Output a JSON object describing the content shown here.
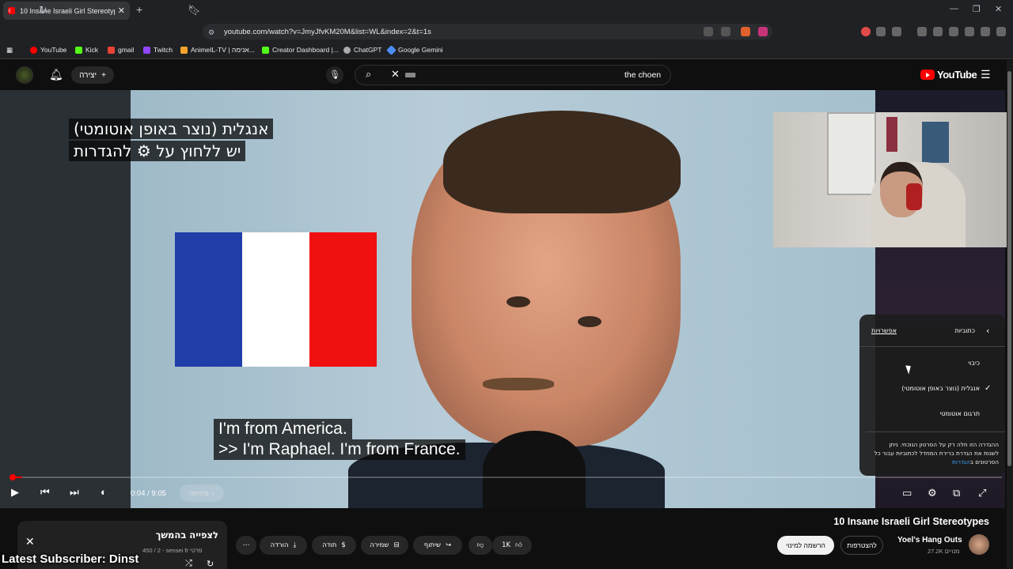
{
  "browser": {
    "tab_title": "10 Insane Israeli Girl Stereotypes",
    "url": "youtube.com/watch?v=JmyJfvKM20M&list=WL&index=2&t=1s",
    "bookmarks": [
      "YouTube",
      "Kick",
      "gmail",
      "Twitch",
      "AnimeIL-TV | אנימה...",
      "Creator Dashboard |...",
      "ChatGPT",
      "Google Gemini"
    ]
  },
  "header": {
    "create_label": "יצירה",
    "search_query": "the choen",
    "logo_text": "YouTube"
  },
  "video": {
    "caption_line1": "אנגלית (נוצר באופן אוטומטי)",
    "caption_line2": "יש ללחוץ על ⚙ להגדרות",
    "subtitle_line1": "I'm from America.",
    "subtitle_line2": ">> I'm Raphael. I'm from France.",
    "time": "0:04 / 9:05",
    "chapter": "פתיחה",
    "progress": 0.007
  },
  "settings_popup": {
    "back_label": "כתוביות",
    "options_label": "אפשרויות",
    "items": [
      "כיבוי",
      "אנגלית (נוצר באופן אוטומטי)",
      "תרגום אוטומטי"
    ],
    "selected_index": 1,
    "note": "ההגדרה הזו חלה רק על הסרטון הנוכחי. ניתן לשנות את הגדרת ברירת המחדל לכתוביות עבור כל הסרטונים ב",
    "note_link": "הגדרות"
  },
  "below": {
    "title": "10 Insane Israeli Girl Stereotypes",
    "channel": "Yoel's Hang Outs",
    "subscribers": "27.2K מנויים",
    "join_label": "להצטרפות",
    "subscribe_label": "הרשמה למינוי",
    "likes": "1K",
    "share_label": "שיתוף",
    "save_label": "שמירה",
    "thanks_label": "תודה",
    "download_label": "הורדה"
  },
  "playlist": {
    "title": "לצפייה בהמשך",
    "meta": "450 / 2 - sensei fr פרטי"
  },
  "overlay_text": "Latest Subscriber: Dinst"
}
